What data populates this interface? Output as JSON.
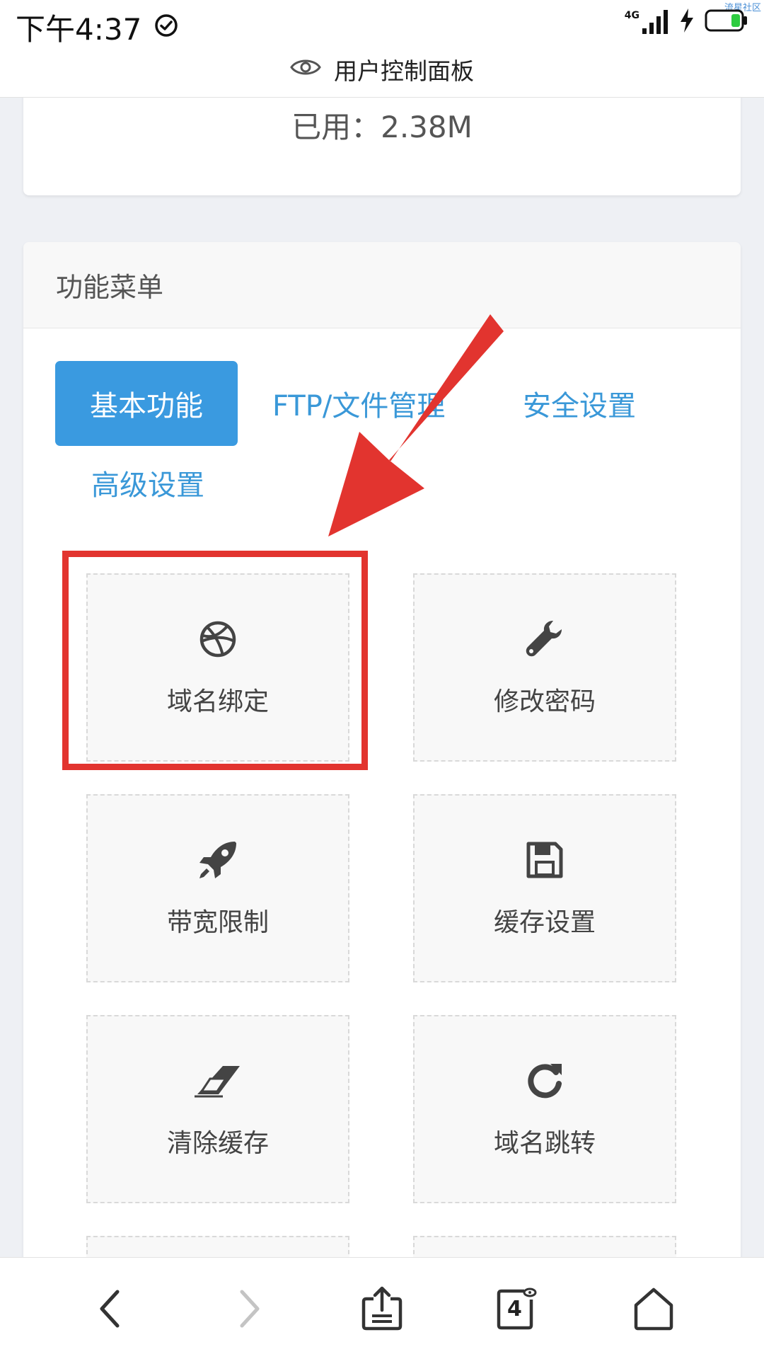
{
  "status_bar": {
    "time": "下午4:37",
    "network": "4G",
    "watermark": "流星社区"
  },
  "browser": {
    "page_title": "用户控制面板",
    "tabs_count": "4"
  },
  "usage": {
    "used_text": "已用：2.38M"
  },
  "menu": {
    "title": "功能菜单",
    "tabs": [
      {
        "label": "基本功能",
        "active": true
      },
      {
        "label": "FTP/文件管理",
        "active": false
      },
      {
        "label": "安全设置",
        "active": false
      },
      {
        "label": "高级设置",
        "active": false
      }
    ],
    "tiles": [
      {
        "label": "域名绑定",
        "icon": "dribbble-icon"
      },
      {
        "label": "修改密码",
        "icon": "wrench-icon"
      },
      {
        "label": "带宽限制",
        "icon": "rocket-icon"
      },
      {
        "label": "缓存设置",
        "icon": "floppy-disk-icon"
      },
      {
        "label": "清除缓存",
        "icon": "eraser-icon"
      },
      {
        "label": "域名跳转",
        "icon": "refresh-icon"
      }
    ]
  },
  "annotation": {
    "highlight_color": "#e2342f",
    "highlighted_tile": "域名绑定"
  },
  "colors": {
    "accent": "#3a9ae0",
    "tab_text": "#3a98d8"
  }
}
